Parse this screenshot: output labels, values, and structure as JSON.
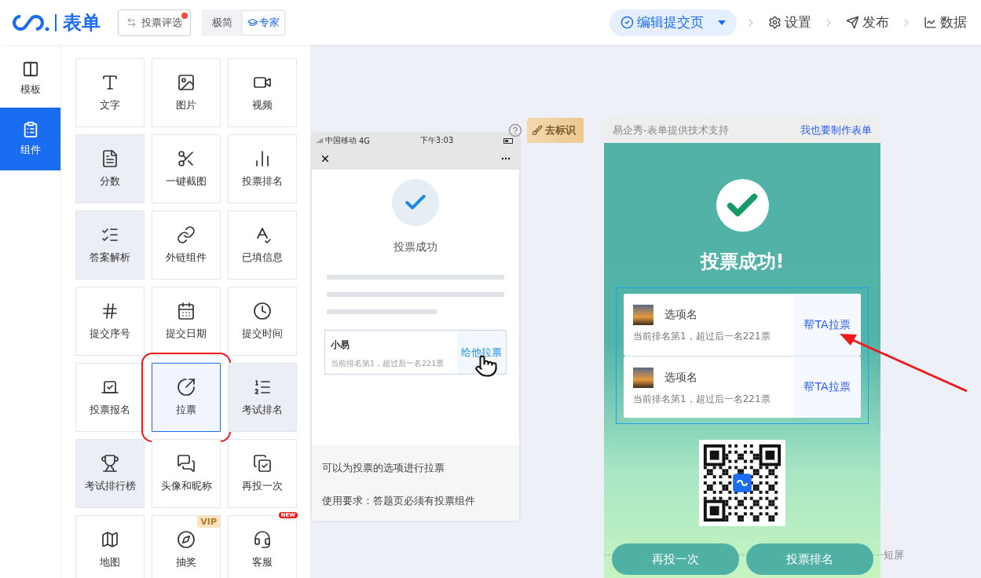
{
  "header": {
    "logo_text": "表单",
    "vote_button": {
      "label": "投票评选",
      "dot": true
    },
    "modes": [
      {
        "label": "极简",
        "selected": false
      },
      {
        "label": "专家",
        "selected": true
      }
    ],
    "steps": [
      {
        "label": "编辑提交页",
        "selected": true
      },
      {
        "label": "设置",
        "selected": false
      },
      {
        "label": "发布",
        "selected": false
      },
      {
        "label": "数据",
        "selected": false
      }
    ]
  },
  "rail": [
    {
      "label": "模板",
      "selected": false
    },
    {
      "label": "组件",
      "selected": true
    }
  ],
  "components": [
    {
      "label": "文字",
      "tinted": false,
      "selected": false,
      "marked": false
    },
    {
      "label": "图片",
      "tinted": false,
      "selected": false,
      "marked": false
    },
    {
      "label": "视频",
      "tinted": false,
      "selected": false,
      "marked": false
    },
    {
      "label": "分数",
      "tinted": true,
      "selected": false,
      "marked": false
    },
    {
      "label": "一键截图",
      "tinted": false,
      "selected": false,
      "marked": false
    },
    {
      "label": "投票排名",
      "tinted": false,
      "selected": false,
      "marked": false
    },
    {
      "label": "答案解析",
      "tinted": true,
      "selected": false,
      "marked": false
    },
    {
      "label": "外链组件",
      "tinted": false,
      "selected": false,
      "marked": false
    },
    {
      "label": "已填信息",
      "tinted": false,
      "selected": false,
      "marked": false
    },
    {
      "label": "提交序号",
      "tinted": false,
      "selected": false,
      "marked": false
    },
    {
      "label": "提交日期",
      "tinted": false,
      "selected": false,
      "marked": false
    },
    {
      "label": "提交时间",
      "tinted": false,
      "selected": false,
      "marked": false
    },
    {
      "label": "投票报名",
      "tinted": false,
      "selected": false,
      "marked": false
    },
    {
      "label": "拉票",
      "tinted": false,
      "selected": true,
      "marked": true
    },
    {
      "label": "考试排名",
      "tinted": true,
      "selected": false,
      "marked": false
    },
    {
      "label": "考试排行榜",
      "tinted": true,
      "selected": false,
      "marked": false
    },
    {
      "label": "头像和昵称",
      "tinted": false,
      "selected": false,
      "marked": false
    },
    {
      "label": "再投一次",
      "tinted": false,
      "selected": false,
      "marked": false
    },
    {
      "label": "地图",
      "tinted": false,
      "selected": false,
      "marked": false
    },
    {
      "label": "抽奖",
      "tinted": false,
      "selected": false,
      "marked": false,
      "badge": {
        "text": "VIP",
        "kind": "vip"
      }
    },
    {
      "label": "客服",
      "tinted": false,
      "selected": false,
      "marked": false,
      "badge": {
        "text": "NEW",
        "kind": "new"
      }
    }
  ],
  "phone_demo": {
    "carrier": "中国移动",
    "network": "4G",
    "time": "下午3:03",
    "title": "投票成功",
    "card": {
      "name": "小易",
      "detail": "当前排名第1，超过后一名221票",
      "action": "给他拉票"
    },
    "notes": [
      "可以为投票的选项进行拉票",
      "使用要求：答题页必须有投票组件"
    ]
  },
  "preview": {
    "remove_mark": "去标识",
    "support_text": "易企秀-表单提供技术支持",
    "make_link": "我也要制作表单",
    "title": "投票成功!",
    "options": [
      {
        "name": "选项名",
        "detail": "当前排名第1，超过后一名221票",
        "action": "帮TA拉票"
      },
      {
        "name": "选项名",
        "detail": "当前排名第1，超过后一名221票",
        "action": "帮TA拉票"
      }
    ],
    "buttons": [
      "再投一次",
      "投票排名"
    ],
    "fold_label": "短屏"
  }
}
